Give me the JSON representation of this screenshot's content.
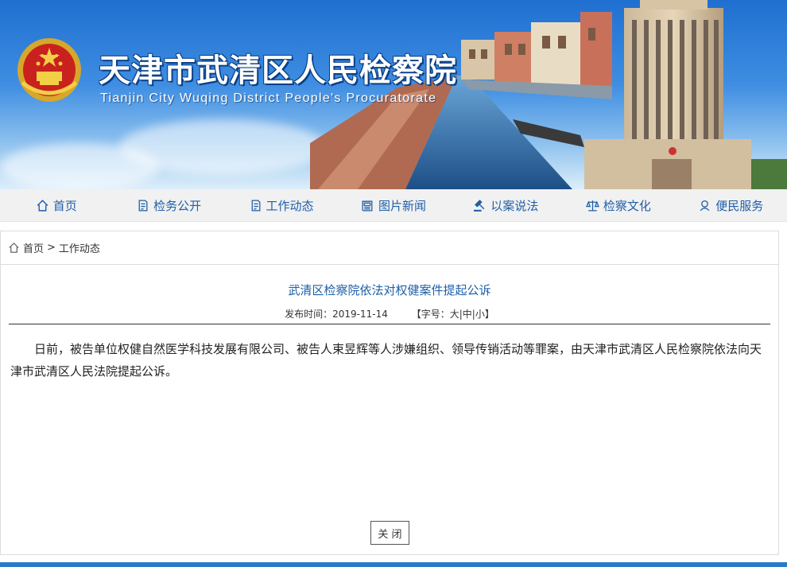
{
  "header": {
    "title": "天津市武清区人民检察院",
    "subtitle": "Tianjin City Wuqing District People's Procuratorate"
  },
  "nav": {
    "items": [
      {
        "label": "首页",
        "icon": "home-icon"
      },
      {
        "label": "检务公开",
        "icon": "document-icon"
      },
      {
        "label": "工作动态",
        "icon": "document-icon"
      },
      {
        "label": "图片新闻",
        "icon": "news-icon"
      },
      {
        "label": "以案说法",
        "icon": "gavel-icon"
      },
      {
        "label": "检察文化",
        "icon": "scales-icon"
      },
      {
        "label": "便民服务",
        "icon": "service-icon"
      }
    ]
  },
  "breadcrumb": {
    "home": "首页",
    "separator": ">",
    "current": "工作动态"
  },
  "article": {
    "title": "武清区检察院依法对权健案件提起公诉",
    "date_label": "发布时间：",
    "date": "2019-11-14",
    "font_size_prefix": "【字号：",
    "font_large": "大",
    "font_medium": "中",
    "font_small": "小",
    "divider": "|",
    "font_size_suffix": "】",
    "body": "日前，被告单位权健自然医学科技发展有限公司、被告人束昱辉等人涉嫌组织、领导传销活动等罪案，由天津市武清区人民检察院依法向天津市武清区人民法院提起公诉。"
  },
  "close_button": "关 闭",
  "colors": {
    "nav_text": "#1f5fa8",
    "title": "#1f5fa8",
    "banner_blue": "#1f6fd1",
    "footer_bar": "#2b78c8"
  }
}
